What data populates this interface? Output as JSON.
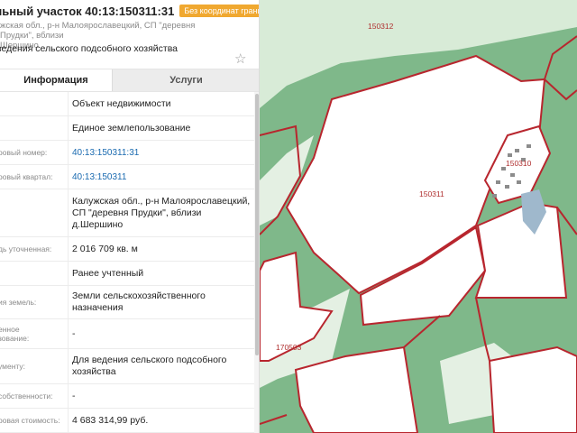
{
  "header": {
    "title": "льный участок 40:13:150311:31",
    "badge": "Без координат границ",
    "address_line1": "жская обл., р-н Малоярославецкий, СП \"деревня Прудки\", вблизи",
    "address_line2": "Шершино",
    "purpose": "ведения сельского подсобного хозяйства"
  },
  "tabs": {
    "info": "Информация",
    "services": "Услуги"
  },
  "rows": [
    {
      "label": "",
      "value": "Объект недвижимости"
    },
    {
      "label": "",
      "value": "Единое землепользование"
    },
    {
      "label": "ровый номер:",
      "value": "40:13:150311:31"
    },
    {
      "label": "ровый квартал:",
      "value": "40:13:150311"
    },
    {
      "label": "",
      "value": "Калужская обл., р-н Малоярославецкий, СП \"деревня Прудки\", вблизи д.Шершино"
    },
    {
      "label": "дь уточненная:",
      "value": "2 016 709 кв. м"
    },
    {
      "label": "",
      "value": "Ранее учтенный"
    },
    {
      "label": "ия земель:",
      "value": "Земли сельскохозяйственного назначения"
    },
    {
      "label": "енное",
      "label2": "зование:",
      "value": "-"
    },
    {
      "label": "ументу:",
      "value": "Для ведения сельского подсобного хозяйства"
    },
    {
      "label": "собственности:",
      "value": "-"
    },
    {
      "label": "ровая стоимость:",
      "value": "4 683 314,99 руб."
    }
  ],
  "map": {
    "labels": {
      "q150312": "150312",
      "q150310": "150310",
      "q150311": "150311",
      "q170503": "170503"
    },
    "colors": {
      "forest": "#7fb88a",
      "field": "#ffffff",
      "boundary": "#b8262e",
      "water": "#9fb8cc",
      "building": "#8c8c8c"
    }
  }
}
